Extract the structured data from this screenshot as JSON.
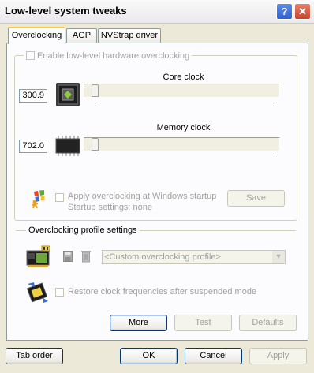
{
  "window": {
    "title": "Low-level system tweaks",
    "help": "?",
    "close": "✕"
  },
  "tabs": [
    {
      "label": "Overclocking",
      "active": true
    },
    {
      "label": "AGP",
      "active": false
    },
    {
      "label": "NVStrap driver",
      "active": false
    }
  ],
  "overclocking": {
    "enable_label": "Enable low-level hardware overclocking",
    "core": {
      "label": "Core clock",
      "value": "300.9",
      "slider_position": 0
    },
    "memory": {
      "label": "Memory clock",
      "value": "702.0",
      "slider_position": 0
    },
    "apply_startup_label": "Apply overclocking at Windows startup",
    "startup_settings": "Startup settings: none",
    "save_label": "Save"
  },
  "profile": {
    "group_label": "Overclocking profile settings",
    "selected": "<Custom overclocking profile>"
  },
  "restore_label": "Restore clock frequencies after suspended mode",
  "actions": {
    "more": "More",
    "test": "Test",
    "defaults": "Defaults"
  },
  "footer": {
    "tab_order": "Tab order",
    "ok": "OK",
    "cancel": "Cancel",
    "apply": "Apply"
  }
}
